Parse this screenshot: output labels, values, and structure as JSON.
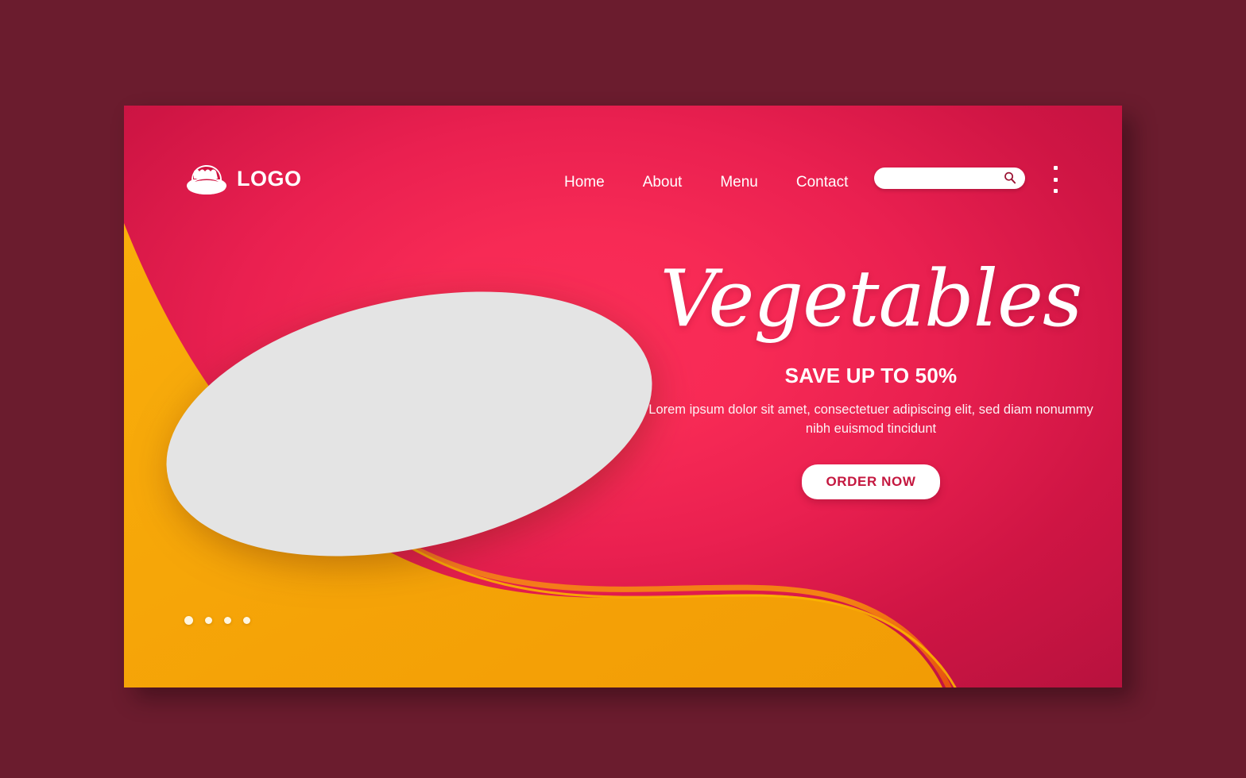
{
  "theme": {
    "page_background": "#6B1C2E",
    "card_pink_center": "#F72A55",
    "card_pink_edge": "#B8123E",
    "accent_orange": "#F5A307",
    "ellipse_gray": "#E4E4E4",
    "cta_text_color": "#C4173F",
    "text_white": "#FFFFFF"
  },
  "header": {
    "brand_label": "LOGO",
    "brand_icon": "salad-bowl-icon",
    "nav_items": [
      {
        "label": "Home"
      },
      {
        "label": "About"
      },
      {
        "label": "Menu"
      },
      {
        "label": "Contact"
      }
    ],
    "search": {
      "value": "",
      "placeholder": "",
      "icon": "search-icon"
    },
    "overflow_menu_icon": "kebab-menu-icon"
  },
  "hero": {
    "title": "Vegetables",
    "subtitle": "SAVE UP TO 50%",
    "body": "Lorem ipsum dolor sit amet, consectetuer adipiscing elit, sed diam nonummy nibh euismod tincidunt",
    "cta_label": "ORDER NOW"
  },
  "carousel": {
    "dots": [
      {
        "active": true
      },
      {
        "active": false
      },
      {
        "active": false
      },
      {
        "active": false
      }
    ]
  },
  "media": {
    "placeholder_shape": "rotated-ellipse-image-placeholder"
  }
}
